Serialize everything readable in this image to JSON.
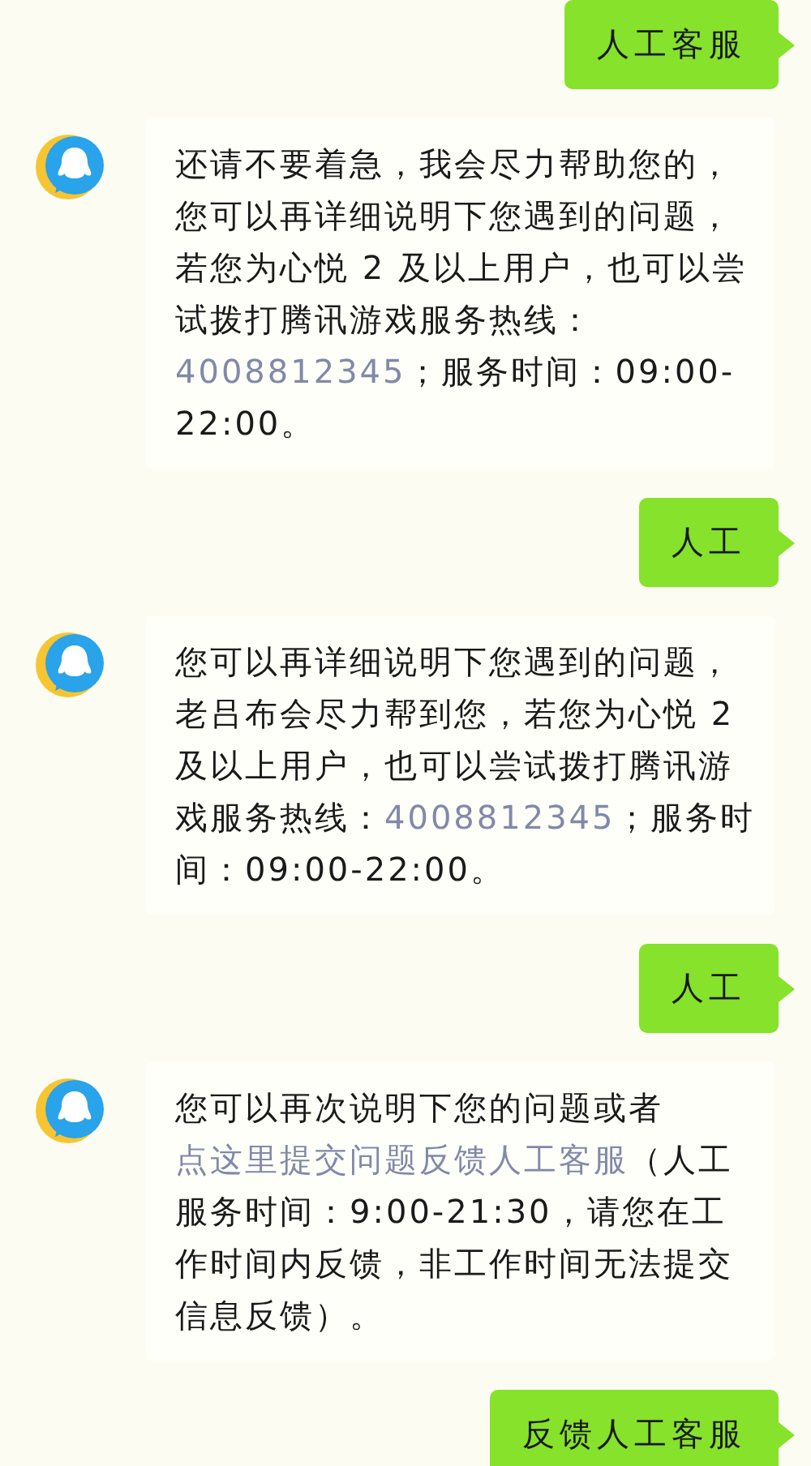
{
  "messages": [
    {
      "kind": "user",
      "text": "人工客服"
    },
    {
      "kind": "agent",
      "parts": [
        {
          "kind": "plain",
          "text": "还请不要着急，我会尽力帮助您的，您可以再详细说明下您遇到的问题，若您为心悦 2 及以上用户，也可以尝试拨打腾讯游戏服务热线："
        },
        {
          "kind": "link",
          "text": "4008812345"
        },
        {
          "kind": "plain",
          "text": "；服务时间：09:00-22:00。"
        }
      ]
    },
    {
      "kind": "user",
      "text": "人工"
    },
    {
      "kind": "agent",
      "parts": [
        {
          "kind": "plain",
          "text": "您可以再详细说明下您遇到的问题，老吕布会尽力帮到您，若您为心悦 2 及以上用户，也可以尝试拨打腾讯游戏服务热线："
        },
        {
          "kind": "link",
          "text": "4008812345"
        },
        {
          "kind": "plain",
          "text": "；服务时间：09:00-22:00。"
        }
      ]
    },
    {
      "kind": "user",
      "text": "人工"
    },
    {
      "kind": "agent",
      "parts": [
        {
          "kind": "plain",
          "text": "您可以再次说明下您的问题或者"
        },
        {
          "kind": "link",
          "text": "点这里提交问题反馈人工客服"
        },
        {
          "kind": "plain",
          "text": "（人工服务时间：9:00-21:30，请您在工作时间内反馈，非工作时间无法提交信息反馈）。"
        }
      ]
    },
    {
      "kind": "user",
      "text": "反馈人工客服"
    }
  ]
}
